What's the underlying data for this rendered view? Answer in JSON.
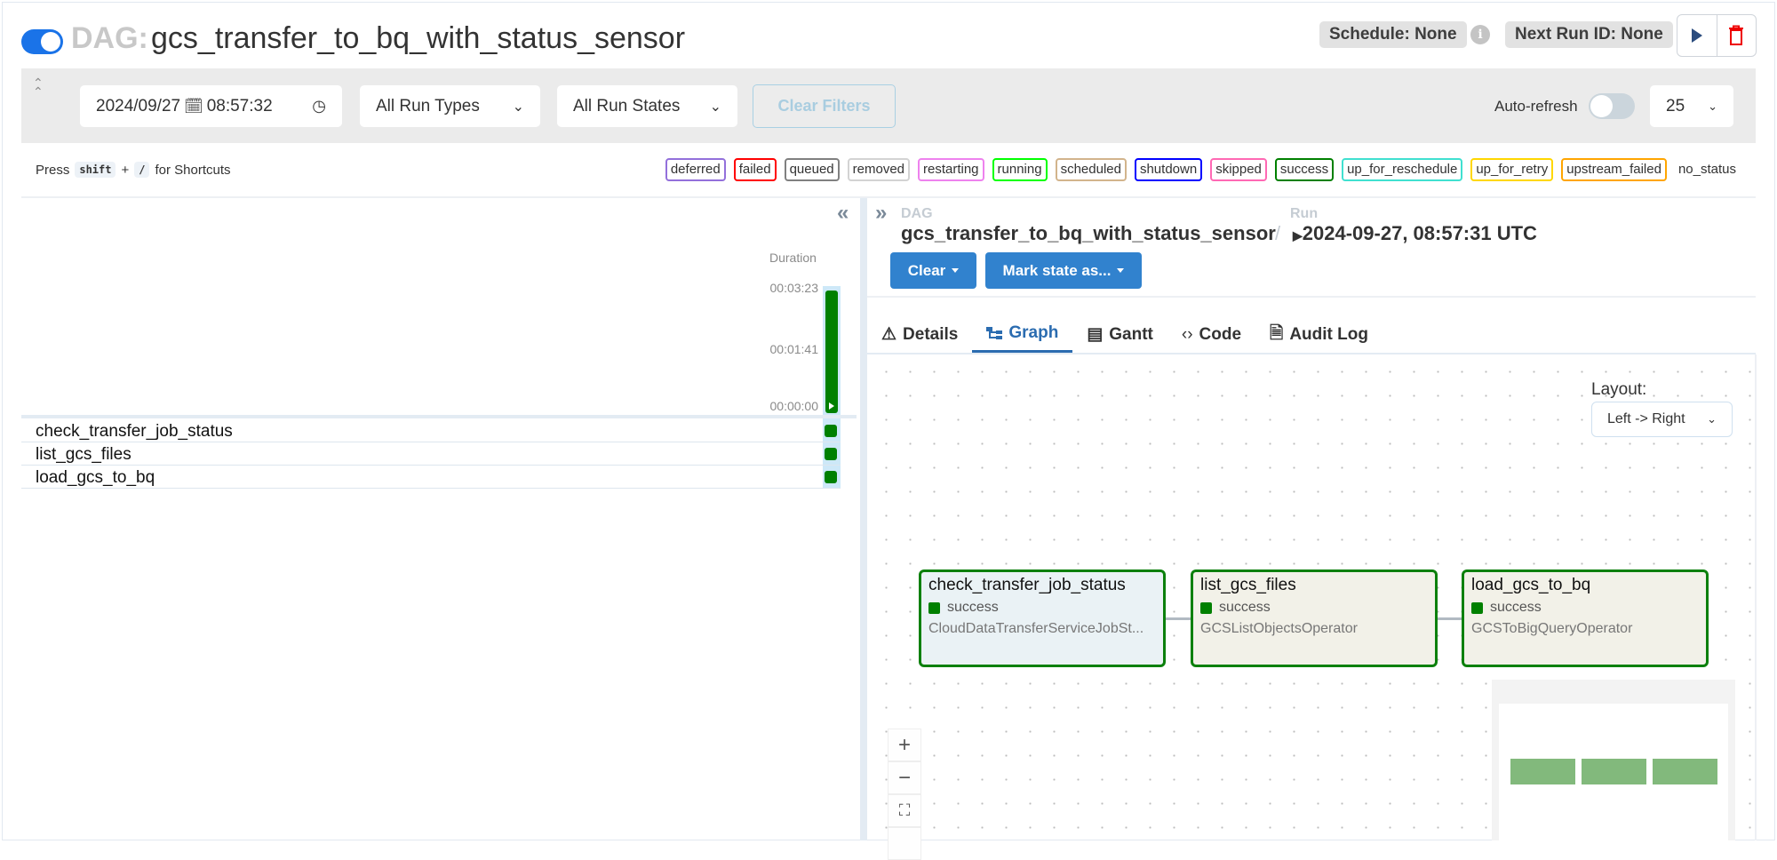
{
  "header": {
    "dag_prefix": "DAG:",
    "dag_id": "gcs_transfer_to_bq_with_status_sensor",
    "schedule": "Schedule: None",
    "next_run": "Next Run ID: None",
    "info_glyph": "i",
    "paused": false
  },
  "filters": {
    "date": "2024/09/27",
    "time": "08:57:32",
    "run_types": "All Run Types",
    "run_states": "All Run States",
    "clear_filters": "Clear Filters",
    "auto_refresh": "Auto-refresh",
    "auto_refresh_on": false,
    "page_size": "25"
  },
  "shortcuts": {
    "press": "Press",
    "key1": "shift",
    "plus": "+",
    "key2": "/",
    "suffix": "for Shortcuts"
  },
  "legend": [
    {
      "label": "deferred",
      "color": "#9370db"
    },
    {
      "label": "failed",
      "color": "#ff0000"
    },
    {
      "label": "queued",
      "color": "#808080"
    },
    {
      "label": "removed",
      "color": "#d3d3d3"
    },
    {
      "label": "restarting",
      "color": "#ee82ee"
    },
    {
      "label": "running",
      "color": "#00ff00"
    },
    {
      "label": "scheduled",
      "color": "#d2b48c"
    },
    {
      "label": "shutdown",
      "color": "#0000ff"
    },
    {
      "label": "skipped",
      "color": "#ff69b4"
    },
    {
      "label": "success",
      "color": "#008000"
    },
    {
      "label": "up_for_reschedule",
      "color": "#40e0d0"
    },
    {
      "label": "up_for_retry",
      "color": "#ffd700"
    },
    {
      "label": "upstream_failed",
      "color": "#ffa500"
    },
    {
      "label": "no_status",
      "color": ""
    }
  ],
  "grid": {
    "duration_label": "Duration",
    "ticks": [
      "00:03:23",
      "00:01:41",
      "00:00:00"
    ],
    "runs": [
      {
        "duration": "00:03:23",
        "state": "success"
      }
    ],
    "tasks": [
      {
        "name": "check_transfer_job_status",
        "state": "success"
      },
      {
        "name": "list_gcs_files",
        "state": "success"
      },
      {
        "name": "load_gcs_to_bq",
        "state": "success"
      }
    ]
  },
  "details": {
    "dag_label": "DAG",
    "dag_value": "gcs_transfer_to_bq_with_status_sensor",
    "run_label": "Run",
    "run_value": "2024-09-27, 08:57:31 UTC",
    "separator": "/",
    "clear_btn": "Clear",
    "mark_state_btn": "Mark state as...",
    "tabs": [
      "Details",
      "Graph",
      "Gantt",
      "Code",
      "Audit Log"
    ],
    "active_tab": "Graph"
  },
  "graph": {
    "layout_label": "Layout:",
    "layout_value": "Left -> Right",
    "nodes": [
      {
        "name": "check_transfer_job_status",
        "state": "success",
        "operator": "CloudDataTransferServiceJobSt..."
      },
      {
        "name": "list_gcs_files",
        "state": "success",
        "operator": "GCSListObjectsOperator"
      },
      {
        "name": "load_gcs_to_bq",
        "state": "success",
        "operator": "GCSToBigQueryOperator"
      }
    ],
    "zoom_in": "+",
    "zoom_out": "−"
  }
}
